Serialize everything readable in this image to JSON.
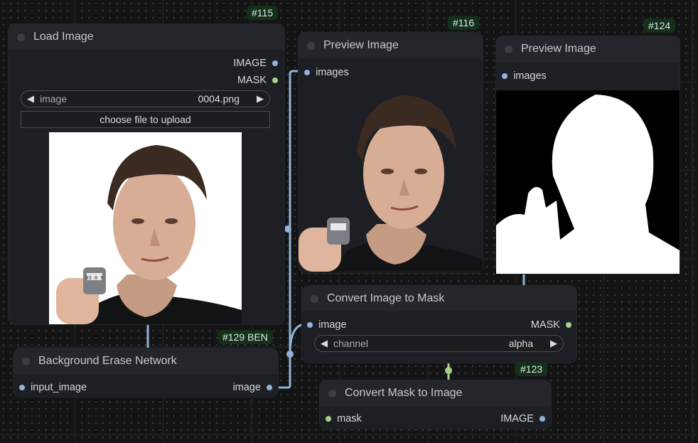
{
  "nodes": {
    "load_image": {
      "badge": "#115",
      "title": "Load Image",
      "out_image": "IMAGE",
      "out_mask": "MASK",
      "widget_label": "image",
      "widget_value": "0004.png",
      "upload_button": "choose file to upload"
    },
    "preview1": {
      "badge": "#116",
      "title": "Preview Image",
      "input": "images"
    },
    "preview2": {
      "badge": "#124",
      "title": "Preview Image",
      "input": "images"
    },
    "convert_img_to_mask": {
      "title": "Convert Image to Mask",
      "input": "image",
      "output": "MASK",
      "widget_label": "channel",
      "widget_value": "alpha"
    },
    "ben": {
      "badge": "#129 BEN",
      "title": "Background Erase Network",
      "input": "input_image",
      "output": "image"
    },
    "convert_mask_to_img": {
      "badge": "#123",
      "title": "Convert Mask to Image",
      "input": "mask",
      "output": "IMAGE"
    }
  },
  "counter_digits": "03 0 8",
  "colors": {
    "image_wire": "#8fb3d9",
    "mask_wire": "#a8d08a",
    "badge_bg": "#13301b"
  }
}
